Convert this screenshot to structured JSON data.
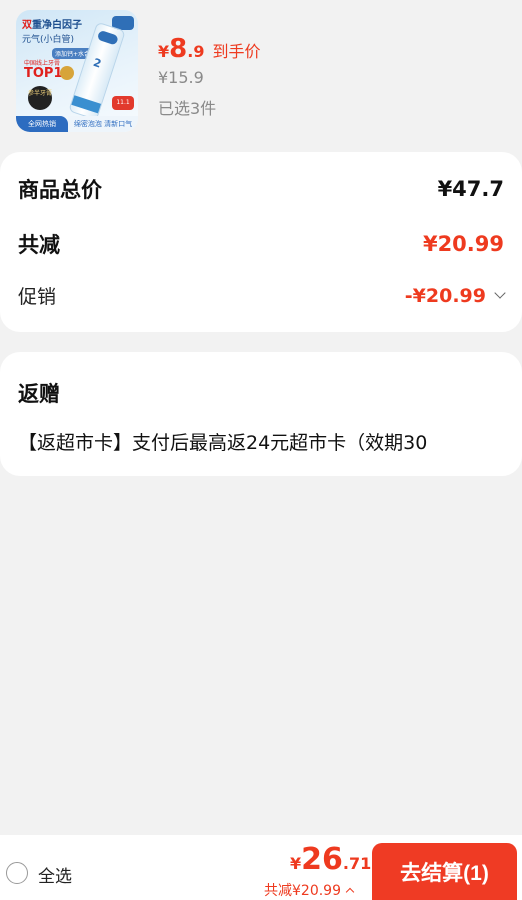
{
  "product": {
    "image": {
      "headline_red": "双",
      "headline_rest": "重净白因子",
      "subline": "元气(小白管)",
      "pill": "添加钙+水合硅石",
      "rank_small": "中国线上牙膏",
      "rank_big": "TOP1",
      "disc_text": "参半牙膏",
      "tube_number": "2",
      "badge": "11.1",
      "bottom_left": "全网热销",
      "bottom_right": "绵密泡泡 清新口气"
    },
    "price_symbol": "¥",
    "price_int": "8",
    "price_dec": ".9",
    "price_label": "到手价",
    "original_price": "¥15.9",
    "selected": "已选3件"
  },
  "summary": {
    "total_label": "商品总价",
    "total_value": "¥47.7",
    "discount_label": "共减",
    "discount_value": "¥20.99",
    "promo_label": "促销",
    "promo_value": "-¥20.99"
  },
  "gift": {
    "title": "返赠",
    "text": "【返超市卡】支付后最高返24元超市卡（效期30"
  },
  "bottom": {
    "select_all": "全选",
    "total_symbol": "¥",
    "total_int": "26",
    "total_dec": ".71",
    "saved_text": "共减¥20.99",
    "checkout_label": "去结算(1)"
  },
  "colors": {
    "accent": "#ef3b24",
    "background": "#f2f2f2"
  }
}
